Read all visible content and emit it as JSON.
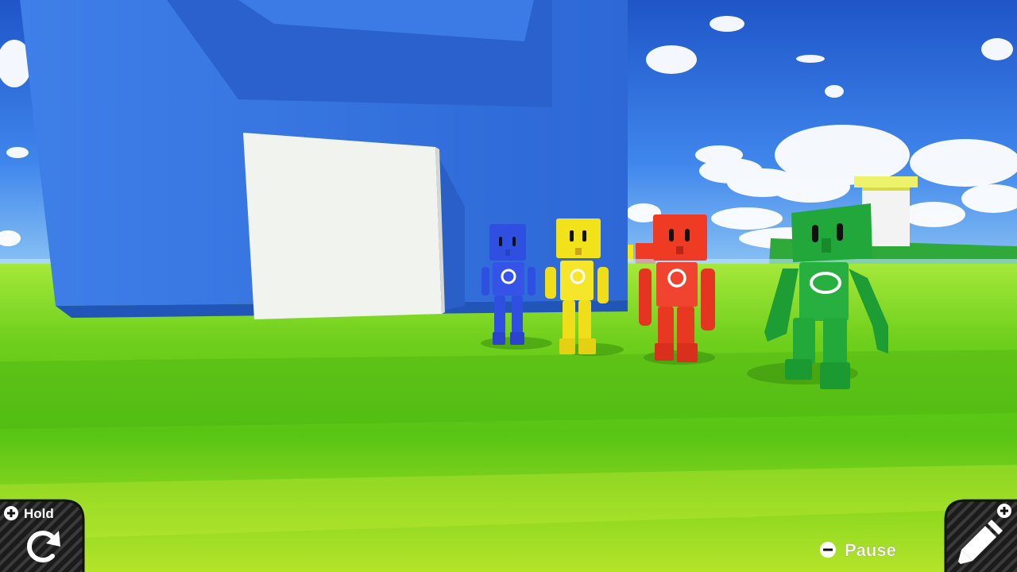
{
  "hud": {
    "hold_prefix_icon": "plus-button-icon",
    "hold_label": "Hold",
    "reset_icon": "reset-rotate-icon",
    "pause_prefix_icon": "minus-button-icon",
    "pause_label": "Pause",
    "edit_prefix_icon": "plus-button-icon",
    "edit_icon": "pencil-icon"
  },
  "scene": {
    "sky_color": "#2f6fe0",
    "grass_color": "#7fd41e",
    "building_color": "#3f7ee6",
    "nodon_colors": {
      "blue": "#2f4fe0",
      "yellow": "#f2e21c",
      "red": "#ef3b24",
      "green": "#22a83a"
    }
  }
}
